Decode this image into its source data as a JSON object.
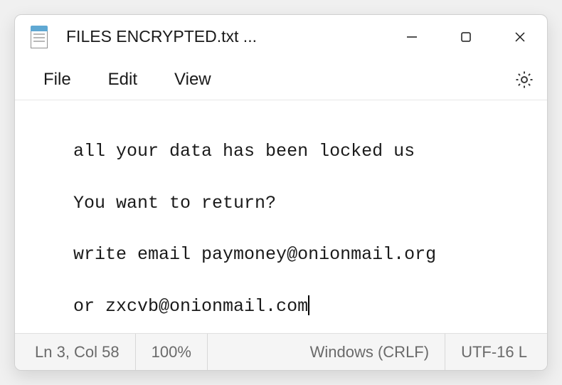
{
  "titlebar": {
    "app_icon": "notepad-icon",
    "title": "FILES ENCRYPTED.txt ..."
  },
  "menubar": {
    "items": [
      {
        "label": "File"
      },
      {
        "label": "Edit"
      },
      {
        "label": "View"
      }
    ],
    "settings_icon": "gear-icon"
  },
  "editor": {
    "lines": [
      "all your data has been locked us",
      "You want to return?",
      "write email paymoney@onionmail.org",
      "or zxcvb@onionmail.com"
    ]
  },
  "statusbar": {
    "position": "Ln 3, Col 58",
    "zoom": "100%",
    "line_ending": "Windows (CRLF)",
    "encoding": "UTF-16 L"
  }
}
